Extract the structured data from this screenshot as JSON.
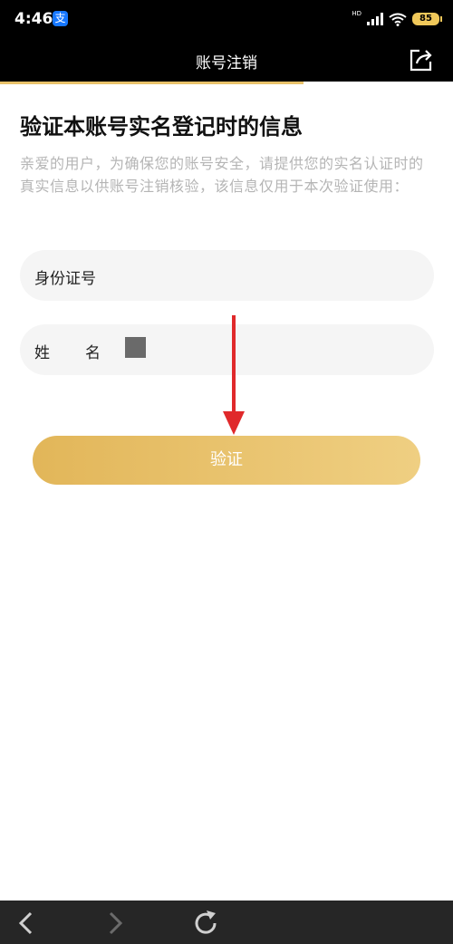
{
  "status_bar": {
    "time": "4:46",
    "app_icon_glyph": "支",
    "network_label": "HD",
    "battery": "85"
  },
  "title_bar": {
    "title": "账号注销"
  },
  "main": {
    "heading": "验证本账号实名登记时的信息",
    "description": "亲爱的用户，为确保您的账号安全，请提供您的实名认证时的真实信息以供账号注销核验，该信息仅用于本次验证使用：",
    "id_field": {
      "label": "身份证号",
      "value": ""
    },
    "name_field": {
      "label": "姓名",
      "value": ""
    },
    "verify_button": "验证"
  },
  "colors": {
    "accent_gold": "#e8c26a",
    "arrow_red": "#e0292b",
    "placeholder_gray": "#b5b5b5"
  },
  "icons": [
    "alipay-icon",
    "signal-icon",
    "wifi-icon",
    "battery-icon",
    "share-icon",
    "back-icon",
    "forward-icon",
    "refresh-icon",
    "red-arrow"
  ]
}
